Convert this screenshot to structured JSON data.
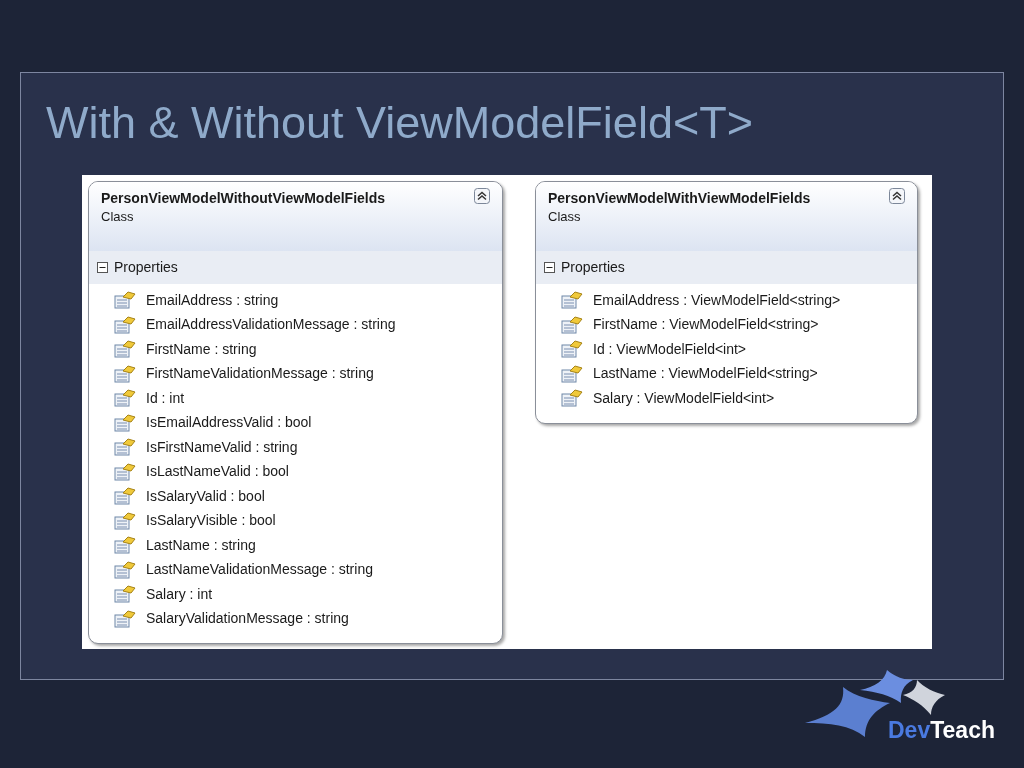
{
  "slide": {
    "title": "With & Without ViewModelField<T>"
  },
  "classes": [
    {
      "name": "PersonViewModelWithoutViewModelFields",
      "kind_label": "Class",
      "compartment": {
        "label": "Properties",
        "expanded": true,
        "members": [
          "EmailAddress : string",
          "EmailAddressValidationMessage : string",
          "FirstName : string",
          "FirstNameValidationMessage : string",
          "Id : int",
          "IsEmailAddressValid : bool",
          "IsFirstNameValid : string",
          "IsLastNameValid : bool",
          "IsSalaryValid : bool",
          "IsSalaryVisible : bool",
          "LastName : string",
          "LastNameValidationMessage : string",
          "Salary : int",
          "SalaryValidationMessage : string"
        ]
      }
    },
    {
      "name": "PersonViewModelWithViewModelFields",
      "kind_label": "Class",
      "compartment": {
        "label": "Properties",
        "expanded": true,
        "members": [
          "EmailAddress : ViewModelField<string>",
          "FirstName : ViewModelField<string>",
          "Id : ViewModelField<int>",
          "LastName : ViewModelField<string>",
          "Salary : ViewModelField<int>"
        ]
      }
    }
  ],
  "logo": {
    "part_1": "Dev",
    "part_2": "Teach"
  }
}
